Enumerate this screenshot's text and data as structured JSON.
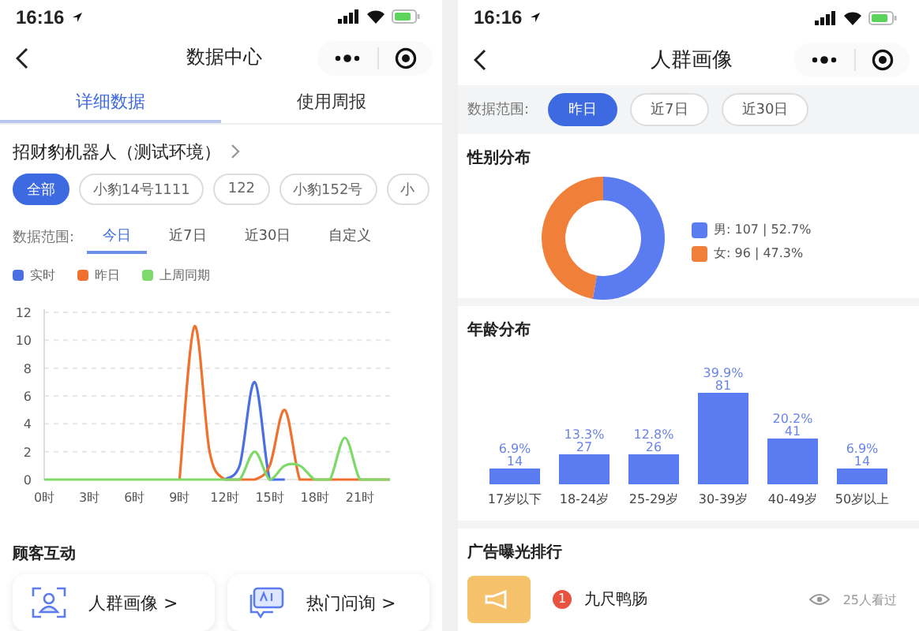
{
  "left_screen": {
    "status_bar": {
      "time": "16:16"
    },
    "nav": {
      "title": "数据中心"
    },
    "tabs": [
      {
        "label": "详细数据",
        "selected": true
      },
      {
        "label": "使用周报",
        "selected": false
      }
    ],
    "robot": {
      "name": "招财豹机器人（测试环境）"
    },
    "chips": [
      {
        "label": "全部",
        "selected": true
      },
      {
        "label": "小豹14号1111",
        "selected": false
      },
      {
        "label": "122",
        "selected": false
      },
      {
        "label": "小豹152号",
        "selected": false
      },
      {
        "label": "小",
        "selected": false
      }
    ],
    "range": {
      "label": "数据范围:",
      "options": [
        {
          "label": "今日",
          "selected": true
        },
        {
          "label": "近7日",
          "selected": false
        },
        {
          "label": "近30日",
          "selected": false
        },
        {
          "label": "自定义",
          "selected": false
        }
      ]
    },
    "chart_data": {
      "type": "line",
      "grid": true,
      "xlim": [
        0,
        23
      ],
      "x": [
        0,
        1,
        2,
        3,
        4,
        5,
        6,
        7,
        8,
        9,
        10,
        11,
        12,
        13,
        14,
        15,
        16,
        17,
        18,
        19,
        20,
        21,
        22,
        23
      ],
      "xticks": [
        {
          "value": 0,
          "label": "0时"
        },
        {
          "value": 3,
          "label": "3时"
        },
        {
          "value": 6,
          "label": "6时"
        },
        {
          "value": 9,
          "label": "9时"
        },
        {
          "value": 12,
          "label": "12时"
        },
        {
          "value": 15,
          "label": "15时"
        },
        {
          "value": 18,
          "label": "18时"
        },
        {
          "value": 21,
          "label": "21时"
        }
      ],
      "yticks": [
        0,
        2,
        4,
        6,
        8,
        10,
        12
      ],
      "ylim": [
        0,
        12
      ],
      "series": [
        {
          "name": "实时",
          "color": "#4a6fe3",
          "values": [
            null,
            null,
            null,
            null,
            null,
            null,
            null,
            null,
            null,
            null,
            null,
            null,
            0,
            1,
            7,
            0,
            0,
            null,
            null,
            null,
            null,
            null,
            null,
            null
          ]
        },
        {
          "name": "昨日",
          "color": "#f0702e",
          "values": [
            null,
            null,
            null,
            null,
            null,
            null,
            null,
            null,
            null,
            0,
            11,
            2,
            0,
            0,
            0,
            1,
            5,
            0,
            0,
            0,
            0,
            0,
            0,
            0
          ]
        },
        {
          "name": "上周同期",
          "color": "#7ed96a",
          "values": [
            0,
            0,
            0,
            0,
            0,
            0,
            0,
            0,
            0,
            0,
            0,
            0,
            0,
            0,
            2,
            0,
            1,
            1,
            0,
            0,
            3,
            0,
            0,
            0
          ]
        }
      ]
    },
    "section_title": "顾客互动",
    "cards": [
      {
        "kind": "portrait",
        "label": "人群画像 >"
      },
      {
        "kind": "chat",
        "label": "热门问询 >"
      }
    ]
  },
  "right_screen": {
    "status_bar": {
      "time": "16:16"
    },
    "nav": {
      "title": "人群画像"
    },
    "range": {
      "label": "数据范围:",
      "options": [
        {
          "label": "昨日",
          "selected": true
        },
        {
          "label": "近7日",
          "selected": false
        },
        {
          "label": "近30日",
          "selected": false
        }
      ]
    },
    "gender": {
      "title": "性别分布",
      "chart_data": {
        "type": "donut",
        "categories": [
          "男",
          "女"
        ],
        "values": [
          52.7,
          47.3
        ],
        "colors": [
          "#5b7cf0",
          "#f07f3a"
        ]
      },
      "legend": [
        ": 107 | 52.7%",
        ": 96 | 47.3%"
      ]
    },
    "age": {
      "title": "年龄分布",
      "chart_data": {
        "type": "bar",
        "categories": [
          "17岁以下",
          "18-24岁",
          "25-29岁",
          "30-39岁",
          "40-49岁",
          "50岁以上"
        ],
        "values": [
          6.9,
          13.3,
          12.8,
          39.9,
          20.2,
          6.9
        ],
        "value_labels": [
          "6.9%",
          "13.3%",
          "12.8%",
          "39.9%",
          "20.2%",
          "6.9%"
        ]
      },
      "counts": [
        "14",
        "27",
        "26",
        "81",
        "41",
        "14"
      ]
    },
    "ads": {
      "title": "广告曝光排行",
      "items": [
        {
          "rank": "1",
          "name": "九尺鸭肠",
          "views": "25人看过"
        }
      ]
    }
  }
}
